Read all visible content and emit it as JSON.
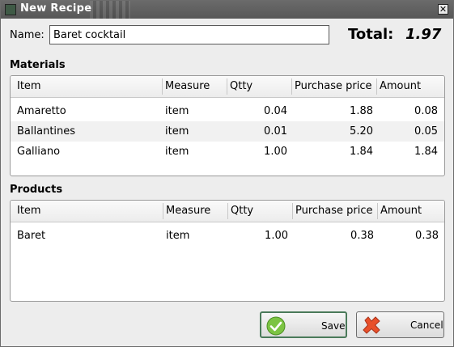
{
  "window": {
    "title": "New Recipe",
    "close_glyph": "✕"
  },
  "form": {
    "name_label": "Name:",
    "name_value": "Baret cocktail"
  },
  "total": {
    "label": "Total:",
    "value": "1.97"
  },
  "materials": {
    "title": "Materials",
    "columns": [
      "Item",
      "Measure",
      "Qtty",
      "Purchase price",
      "Amount"
    ],
    "rows": [
      [
        "Amaretto",
        "item",
        "0.04",
        "1.88",
        "0.08"
      ],
      [
        "Ballantines",
        "item",
        "0.01",
        "5.20",
        "0.05"
      ],
      [
        "Galliano",
        "item",
        "1.00",
        "1.84",
        "1.84"
      ]
    ]
  },
  "products": {
    "title": "Products",
    "columns": [
      "Item",
      "Measure",
      "Qtty",
      "Purchase price",
      "Amount"
    ],
    "rows": [
      [
        "Baret",
        "item",
        "1.00",
        "0.38",
        "0.38"
      ]
    ]
  },
  "buttons": {
    "save": {
      "label": "Save",
      "icon": "checkmark-icon",
      "color": "#6fbf3f"
    },
    "cancel": {
      "label": "Cancel",
      "icon": "cross-icon",
      "color": "#e8502a"
    }
  }
}
